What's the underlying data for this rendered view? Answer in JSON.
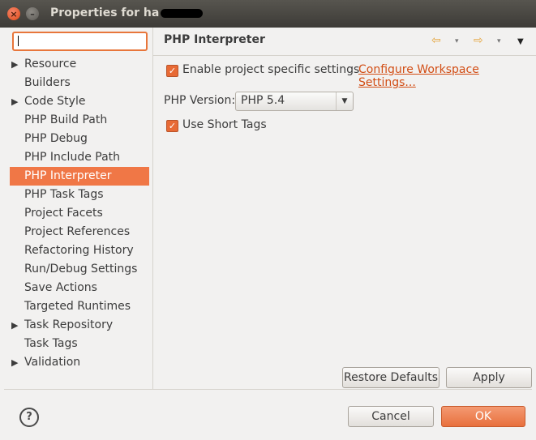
{
  "window": {
    "title": "Properties for ha"
  },
  "filter": {
    "value": "",
    "clear_icon": "⌫"
  },
  "tree": {
    "items": [
      {
        "label": "Resource",
        "expandable": true
      },
      {
        "label": "Builders",
        "expandable": false
      },
      {
        "label": "Code Style",
        "expandable": true
      },
      {
        "label": "PHP Build Path",
        "expandable": false
      },
      {
        "label": "PHP Debug",
        "expandable": false
      },
      {
        "label": "PHP Include Path",
        "expandable": false
      },
      {
        "label": "PHP Interpreter",
        "expandable": false,
        "selected": true
      },
      {
        "label": "PHP Task Tags",
        "expandable": false
      },
      {
        "label": "Project Facets",
        "expandable": false
      },
      {
        "label": "Project References",
        "expandable": false
      },
      {
        "label": "Refactoring History",
        "expandable": false
      },
      {
        "label": "Run/Debug Settings",
        "expandable": false
      },
      {
        "label": "Save Actions",
        "expandable": false
      },
      {
        "label": "Targeted Runtimes",
        "expandable": false
      },
      {
        "label": "Task Repository",
        "expandable": true
      },
      {
        "label": "Task Tags",
        "expandable": false
      },
      {
        "label": "Validation",
        "expandable": true
      }
    ]
  },
  "page": {
    "title": "PHP Interpreter",
    "enable_specific": {
      "label": "Enable project specific settings",
      "checked": true
    },
    "configure_link": "Configure Workspace Settings...",
    "php_version": {
      "label": "PHP Version:",
      "selected": "PHP 5.4"
    },
    "short_tags": {
      "label": "Use Short Tags",
      "checked": true
    }
  },
  "buttons": {
    "restore_defaults": "Restore Defaults",
    "apply": "Apply",
    "cancel": "Cancel",
    "ok": "OK"
  },
  "icons": {
    "back": "⇦",
    "forward": "⇨",
    "dropdown": "▾",
    "menu": "▼",
    "expand": "▶",
    "check": "✓",
    "help": "?",
    "close": "×",
    "minimize": "–"
  },
  "colors": {
    "accent": "#f07746",
    "link": "#d24d14"
  }
}
